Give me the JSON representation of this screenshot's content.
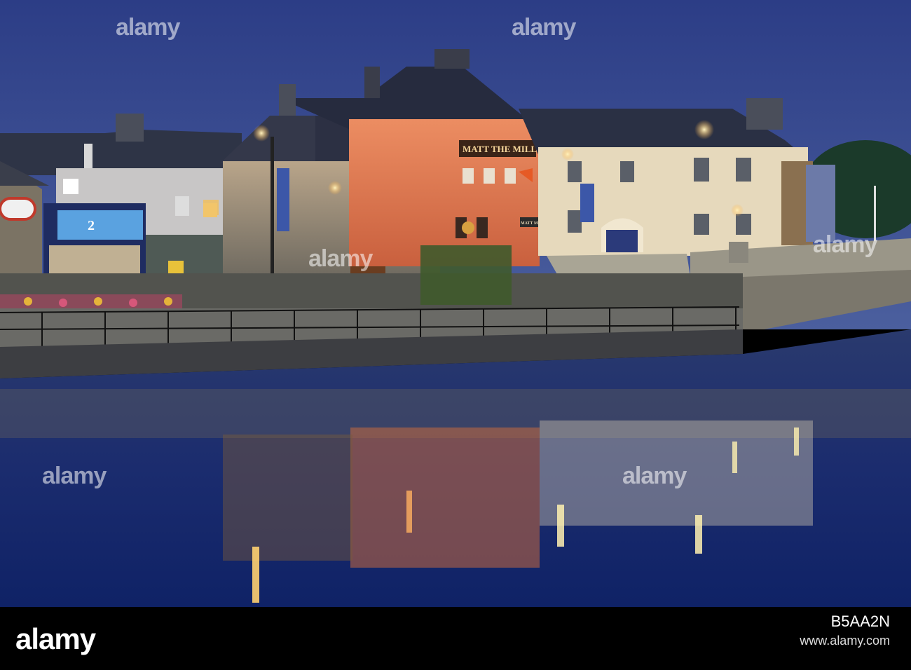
{
  "photo": {
    "pub_sign": "MATT THE MILLER'S",
    "shop_sign": "2",
    "small_sign": "MATT MILLERS"
  },
  "watermark": {
    "text": "alamy"
  },
  "footer": {
    "logo": "alamy",
    "image_code": "B5AA2N",
    "address": "www.alamy.com"
  },
  "colors": {
    "sky": "#3a4f93",
    "water": "#13286a",
    "pub_wall": "#e0835a",
    "house_wall": "#e8dcc0",
    "stone": "#8a806e"
  }
}
